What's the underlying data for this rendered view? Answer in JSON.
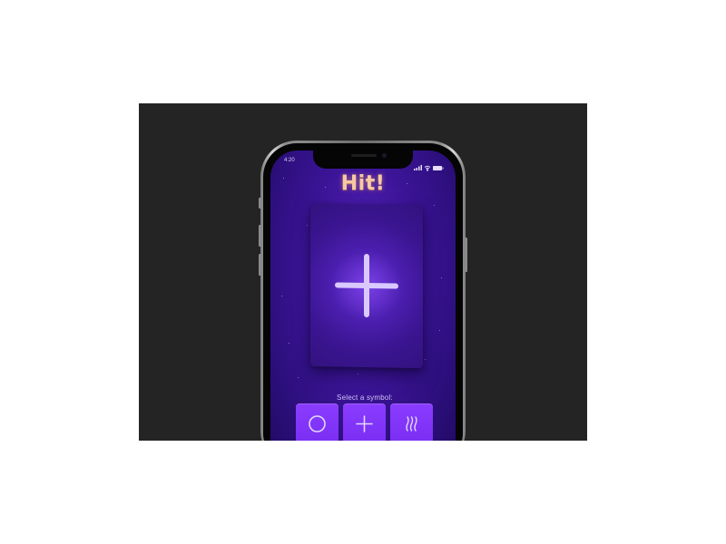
{
  "status_bar": {
    "time": "4:20"
  },
  "game": {
    "result_title": "Hit!",
    "card_symbol_icon": "plus-icon",
    "prompt": "Select a symbol:",
    "symbols": [
      {
        "name": "circle",
        "icon": "circle-icon"
      },
      {
        "name": "plus",
        "icon": "plus-icon"
      },
      {
        "name": "waves",
        "icon": "waves-icon"
      }
    ]
  },
  "colors": {
    "background": "#242424",
    "screen": "#3b1496",
    "title": "#f6c9a4",
    "button": "#8a3dff",
    "symbol_stroke": "#e4d6ff"
  }
}
